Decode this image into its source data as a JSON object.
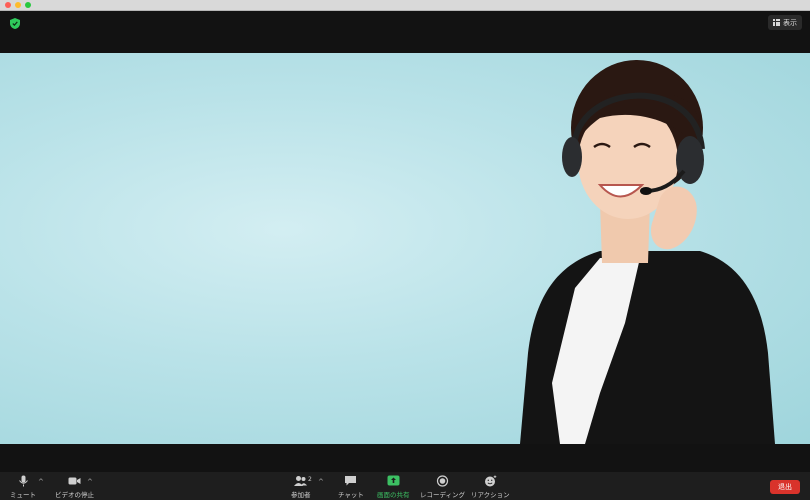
{
  "topbar": {
    "view_label": "表示"
  },
  "toolbar": {
    "mute_label": "ミュート",
    "video_label": "ビデオの停止",
    "participants_label": "参加者",
    "participants_count": "2",
    "chat_label": "チャット",
    "share_label": "画面の共有",
    "record_label": "レコーディング",
    "reaction_label": "リアクション",
    "leave_label": "退出"
  },
  "colors": {
    "share_accent": "#3cc063",
    "leave_red": "#d9332b",
    "shield_green": "#2fc95b"
  }
}
